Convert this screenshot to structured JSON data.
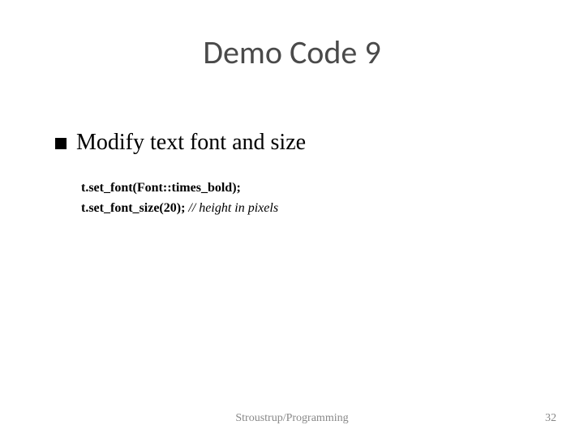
{
  "slide": {
    "title": "Demo Code 9",
    "bullet": "Modify text font and size",
    "code": {
      "line1": "t.set_font(Font::times_bold);",
      "line2_bold": "t.set_font_size(20);",
      "line2_comment": "  // height in pixels"
    },
    "footer": "Stroustrup/Programming",
    "page_number": "32"
  }
}
